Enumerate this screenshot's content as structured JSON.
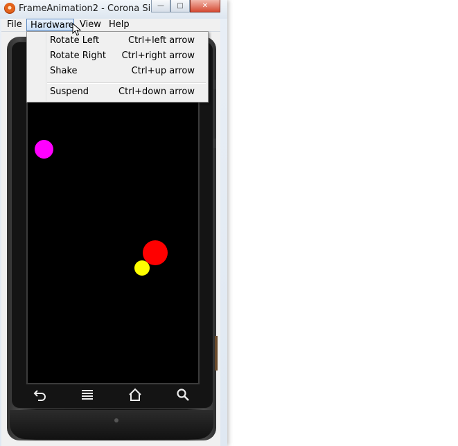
{
  "window": {
    "title": "FrameAnimation2 - Corona Si...",
    "minimize_glyph": "—",
    "maximize_glyph": "□",
    "close_glyph": "✕"
  },
  "menubar": {
    "items": [
      "File",
      "Hardware",
      "View",
      "Help"
    ],
    "active_item": "Hardware"
  },
  "hardware_menu": {
    "items": [
      {
        "label": "Rotate Left",
        "shortcut": "Ctrl+left arrow"
      },
      {
        "label": "Rotate Right",
        "shortcut": "Ctrl+right arrow"
      },
      {
        "label": "Shake",
        "shortcut": "Ctrl+up arrow"
      },
      {
        "label": "Suspend",
        "shortcut": "Ctrl+down arrow"
      }
    ]
  },
  "simulator": {
    "balls": [
      {
        "name": "magenta-ball",
        "color": "#ff00ff"
      },
      {
        "name": "red-ball",
        "color": "#ff0000"
      },
      {
        "name": "yellow-ball",
        "color": "#ffff00"
      }
    ],
    "nav_icons": [
      "back-icon",
      "menu-icon",
      "home-icon",
      "search-icon"
    ]
  },
  "colors": {
    "screen": "#000000",
    "menu_highlight": "#c9def7"
  }
}
